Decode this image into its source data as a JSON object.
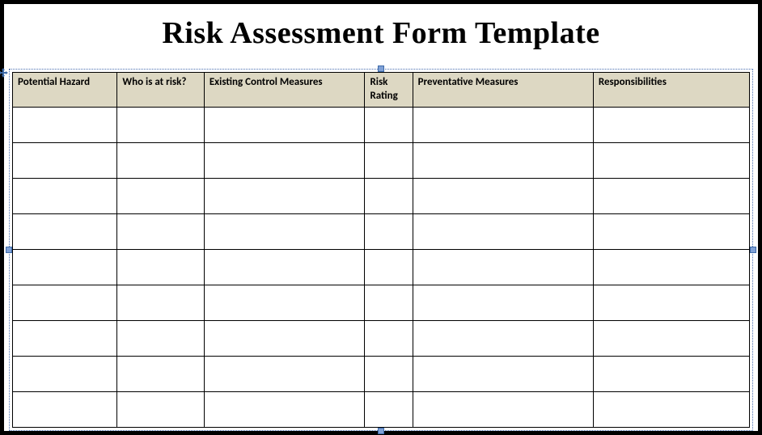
{
  "title": "Risk Assessment Form Template",
  "table": {
    "headers": [
      "Potential Hazard",
      "Who is at risk?",
      "Existing Control Measures",
      "Risk Rating",
      "Preventative Measures",
      "Responsibilities"
    ],
    "rows": [
      [
        "",
        "",
        "",
        "",
        "",
        ""
      ],
      [
        "",
        "",
        "",
        "",
        "",
        ""
      ],
      [
        "",
        "",
        "",
        "",
        "",
        ""
      ],
      [
        "",
        "",
        "",
        "",
        "",
        ""
      ],
      [
        "",
        "",
        "",
        "",
        "",
        ""
      ],
      [
        "",
        "",
        "",
        "",
        "",
        ""
      ],
      [
        "",
        "",
        "",
        "",
        "",
        ""
      ],
      [
        "",
        "",
        "",
        "",
        "",
        ""
      ],
      [
        "",
        "",
        "",
        "",
        "",
        ""
      ]
    ]
  }
}
